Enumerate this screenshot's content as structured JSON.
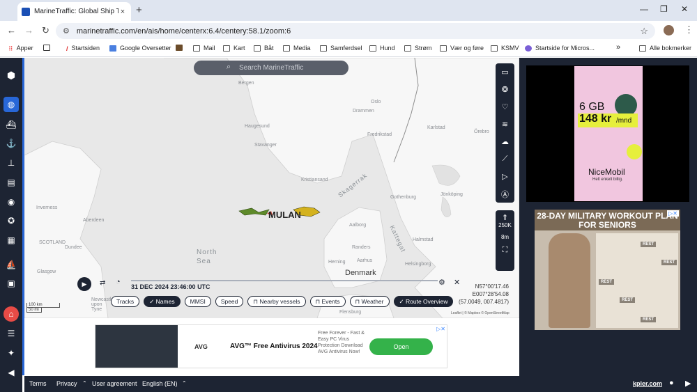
{
  "browser": {
    "tab_title": "MarineTraffic: Global Ship Track",
    "tab_close": "×",
    "new_tab": "+",
    "url": "marinetraffic.com/en/ais/home/centerx:6.4/centery:58.1/zoom:6",
    "bookmarks": [
      "Apper",
      "Startsiden",
      "Google Oversetter",
      "Mail",
      "Kart",
      "Båt",
      "Media",
      "Samferdsel",
      "Hund",
      "Strøm",
      "Vær og føre",
      "KSMV",
      "Startside for Micros...",
      "Alle bokmerker"
    ],
    "more_bookmarks": "»"
  },
  "map": {
    "search_placeholder": "Search MarineTraffic",
    "places": {
      "bergen": "Bergen",
      "oslo": "Oslo",
      "drammen": "Drammen",
      "haugesund": "Haugesund",
      "fredrikstad": "Fredrikstad",
      "karlstad": "Karlstad",
      "orebro": "Örebro",
      "stavanger": "Stavanger",
      "kristiansand": "Kristiansand",
      "jonkoping": "Jönköping",
      "goteborg": "Gothenburg",
      "inverness": "Inverness",
      "aberdeen": "Aberdeen",
      "scotland": "SCOTLAND",
      "dundee": "Dundee",
      "glasgow": "Glasgow",
      "aalborg": "Aalborg",
      "halmstad": "Halmstad",
      "randers": "Randers",
      "aarhus": "Aarhus",
      "herning": "Herning",
      "helsingborg": "Helsingborg",
      "newcastle": "Newcastle upon Tyne",
      "flensburg": "Flensburg"
    },
    "seas": {
      "north_sea": "North Sea",
      "skagerrak": "Skagerrak",
      "kattegat": "Kattegat"
    },
    "country": "Denmark",
    "vessel_name": "MULAN",
    "timestamp": "31 DEC 2024 23:46:00 UTC",
    "filters": [
      {
        "label": "Tracks",
        "on": false
      },
      {
        "label": "Names",
        "on": true
      },
      {
        "label": "MMSI",
        "on": false
      },
      {
        "label": "Speed",
        "on": false
      },
      {
        "label": "Nearby vessels",
        "on": false
      },
      {
        "label": "Events",
        "on": false
      },
      {
        "label": "Weather",
        "on": false
      },
      {
        "label": "Route Overview",
        "on": true
      }
    ],
    "coords": {
      "lat": "N57°00'17.46",
      "lon": "E007°28'54.08",
      "decimal": "(57.0049, 007.4817)"
    },
    "scale_km": "100 km",
    "scale_mi": "50 mi",
    "zoom_level": "250K",
    "altitude": "8m",
    "attribution": "Leaflet | © Mapbox © OpenStreetMap"
  },
  "ads": {
    "nicemobil": {
      "data": "6 GB",
      "price": "148 kr",
      "unit": "/mnd",
      "brand": "NiceMobil",
      "tagline": "Helt enkelt billig."
    },
    "workout": {
      "title": "28-DAY MILITARY WORKOUT PLAN FOR SENIORS",
      "rest": "REST"
    },
    "avg": {
      "brand": "AVG",
      "title": "AVG™ Free Antivirus 2024",
      "desc": "Free Forever - Fast & Easy PC Virus Protection Download AVG Antivirus Now!",
      "cta": "Open"
    }
  },
  "footer": {
    "terms": "Terms",
    "privacy": "Privacy",
    "user_agreement": "User agreement",
    "language": "English (EN)",
    "brand": "kpler.com"
  },
  "colors": {
    "sidebar": "#1d2433",
    "accent": "#2867d8",
    "alert": "#e84b46"
  }
}
